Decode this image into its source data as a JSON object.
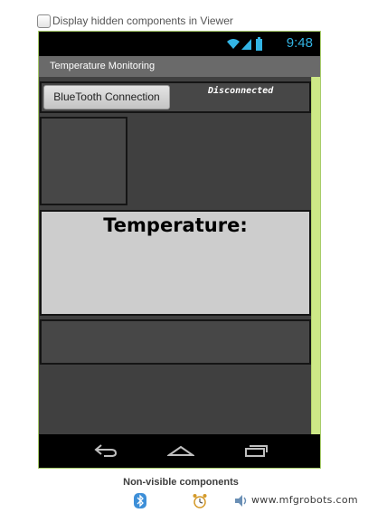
{
  "viewer_option": {
    "label": "Display hidden components in Viewer",
    "checked": false
  },
  "status_bar": {
    "time": "9:48",
    "icons": [
      "wifi-icon",
      "signal-icon",
      "battery-icon"
    ]
  },
  "screen": {
    "title": "Temperature Monitoring"
  },
  "bluetooth_row": {
    "button_label": "BlueTooth Connection",
    "status_text": "Disconnected"
  },
  "temperature_panel": {
    "label": "Temperature:"
  },
  "nav_bar": {
    "buttons": [
      "back-icon",
      "home-icon",
      "recent-apps-icon"
    ]
  },
  "non_visible": {
    "title": "Non-visible components",
    "components": [
      "bluetooth-client-icon",
      "clock-timer-icon",
      "sound-icon"
    ]
  },
  "watermark": "www.mfgrobots.com",
  "colors": {
    "accent": "#33b5e5",
    "screen_bg": "#404040",
    "panel_bg": "#cdcdcd",
    "phone_border": "#a8cc6a"
  }
}
